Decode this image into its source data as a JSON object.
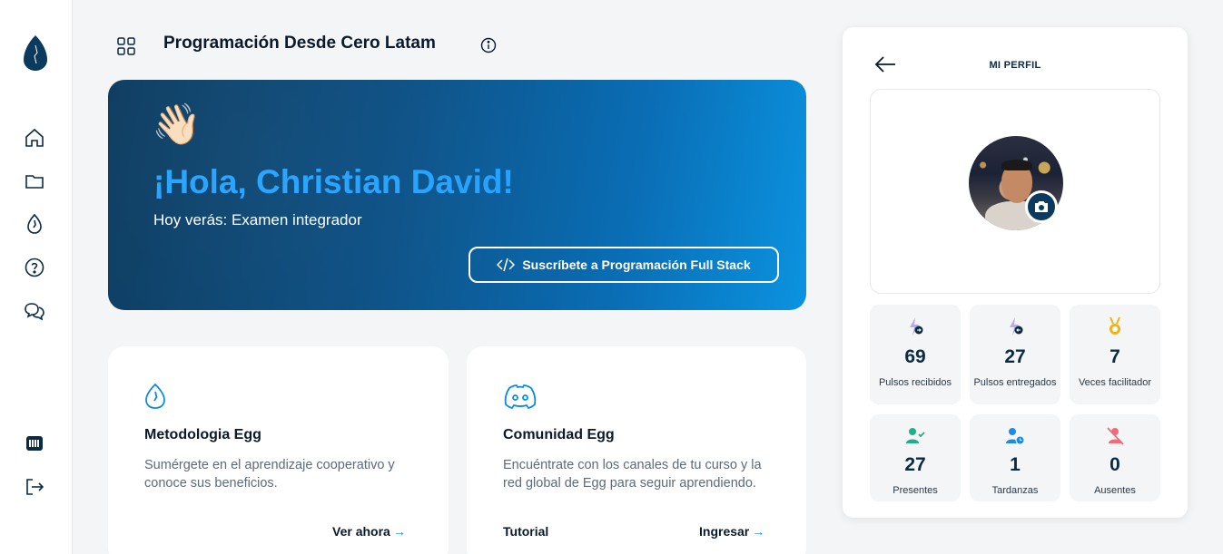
{
  "header": {
    "title": "Programación Desde Cero Latam"
  },
  "sidebar": {
    "items": [
      {
        "name": "home",
        "icon": "home-icon"
      },
      {
        "name": "folder",
        "icon": "folder-icon"
      },
      {
        "name": "egg",
        "icon": "egg-icon"
      },
      {
        "name": "help",
        "icon": "help-icon"
      },
      {
        "name": "chat",
        "icon": "chat-icon"
      },
      {
        "name": "keyboard",
        "icon": "keyboard-icon"
      },
      {
        "name": "logout",
        "icon": "logout-icon"
      }
    ]
  },
  "hero": {
    "greeting": "¡Hola, Christian David!",
    "subtitle": "Hoy verás: Examen integrador",
    "button_label": "Suscríbete a Programación Full Stack",
    "emoji": "👋🏻"
  },
  "cards": {
    "methodology": {
      "title": "Metodologia Egg",
      "description": "Sumérgete en el aprendizaje cooperativo y conoce sus beneficios.",
      "link": "Ver ahora"
    },
    "community": {
      "title": "Comunidad Egg",
      "description": "Encuéntrate con los canales de tu curso y la red global de Egg para seguir aprendiendo.",
      "link_tutorial": "Tutorial",
      "link_enter": "Ingresar"
    }
  },
  "profile": {
    "title": "MI PERFIL",
    "stats": [
      {
        "value": "69",
        "label": "Pulsos recibidos",
        "icon": "pulse-received-icon"
      },
      {
        "value": "27",
        "label": "Pulsos entregados",
        "icon": "pulse-delivered-icon"
      },
      {
        "value": "7",
        "label": "Veces facilitador",
        "icon": "medal-icon"
      },
      {
        "value": "27",
        "label": "Presentes",
        "icon": "user-check-icon"
      },
      {
        "value": "1",
        "label": "Tardanzas",
        "icon": "user-clock-icon"
      },
      {
        "value": "0",
        "label": "Ausentes",
        "icon": "user-x-icon"
      }
    ]
  },
  "colors": {
    "accent": "#24a2ff",
    "navy": "#0b3a5e",
    "link_arrow": "#0a8ce0"
  }
}
